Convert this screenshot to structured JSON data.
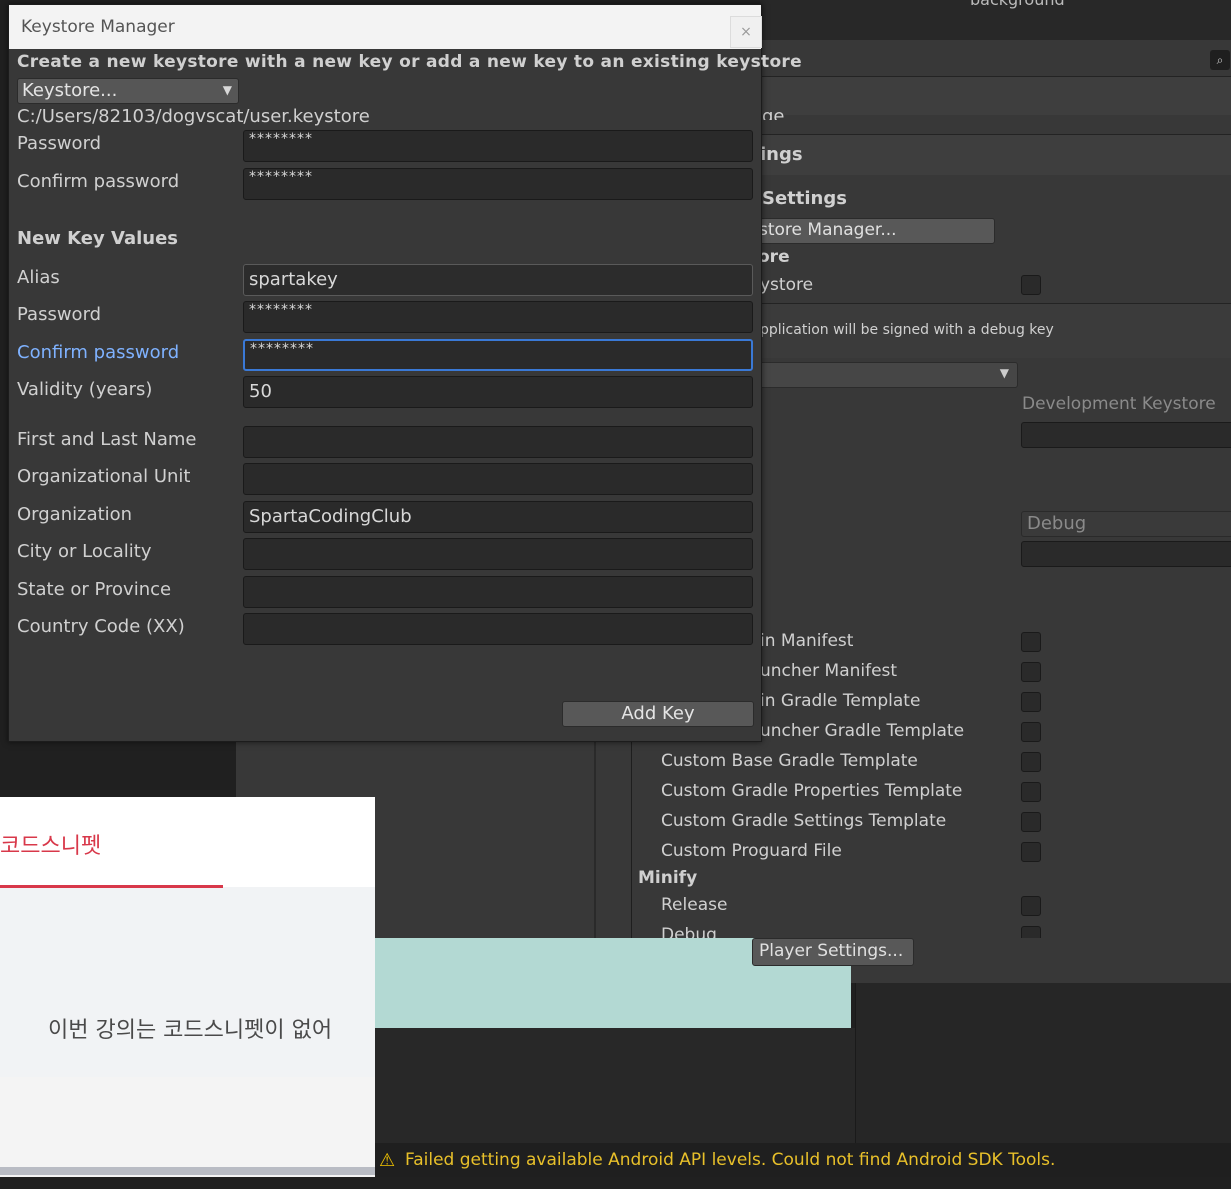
{
  "dialog": {
    "title": "Keystore Manager",
    "close_label": "×",
    "heading": "Create a new keystore with a new key or add a new key to an existing keystore",
    "keystore_dropdown": "Keystore...",
    "keystore_path": "C:/Users/82103/dogvscat/user.keystore",
    "ks_password_label": "Password",
    "ks_password_value": "********",
    "ks_confirm_label": "Confirm password",
    "ks_confirm_value": "********",
    "new_key_heading": "New Key Values",
    "alias_label": "Alias",
    "alias_value": "spartakey",
    "key_password_label": "Password",
    "key_password_value": "********",
    "key_confirm_label": "Confirm password",
    "key_confirm_value": "********",
    "validity_label": "Validity (years)",
    "validity_value": "50",
    "first_last_label": "First and Last Name",
    "first_last_value": "",
    "org_unit_label": "Organizational Unit",
    "org_unit_value": "",
    "org_label": "Organization",
    "org_value": "SpartaCodingClub",
    "city_label": "City or Locality",
    "city_value": "",
    "state_label": "State or Province",
    "state_value": "",
    "country_label": "Country Code (XX)",
    "country_value": "",
    "add_key_label": "Add Key"
  },
  "settings": {
    "partial_1": "ge",
    "partial_2": "ings",
    "publishing_settings": "Settings",
    "keystore_manager_btn": "store Manager...",
    "keystore_section": "ore",
    "custom_keystore": "ystore",
    "debug_note": "pplication will be signed with a debug key",
    "dev_keystore_label": "Development Keystore",
    "debug_value": "Debug",
    "items": [
      "in Manifest",
      "uncher Manifest",
      "in Gradle Template",
      "uncher Gradle Template",
      "Custom Base Gradle Template",
      "Custom Gradle Properties Template",
      "Custom Gradle Settings Template",
      "Custom Proguard File"
    ],
    "minify_heading": "Minify",
    "minify_release": "Release",
    "minify_debug": "Debug",
    "player_settings_btn": "Player Settings..."
  },
  "background": {
    "korean_tab": "코드스니펫",
    "korean_text": "이번 강의는 코드스니펫이 없어",
    "top_partial": "background"
  },
  "status": {
    "message": "Failed getting available Android API levels. Could not find Android SDK Tools."
  }
}
